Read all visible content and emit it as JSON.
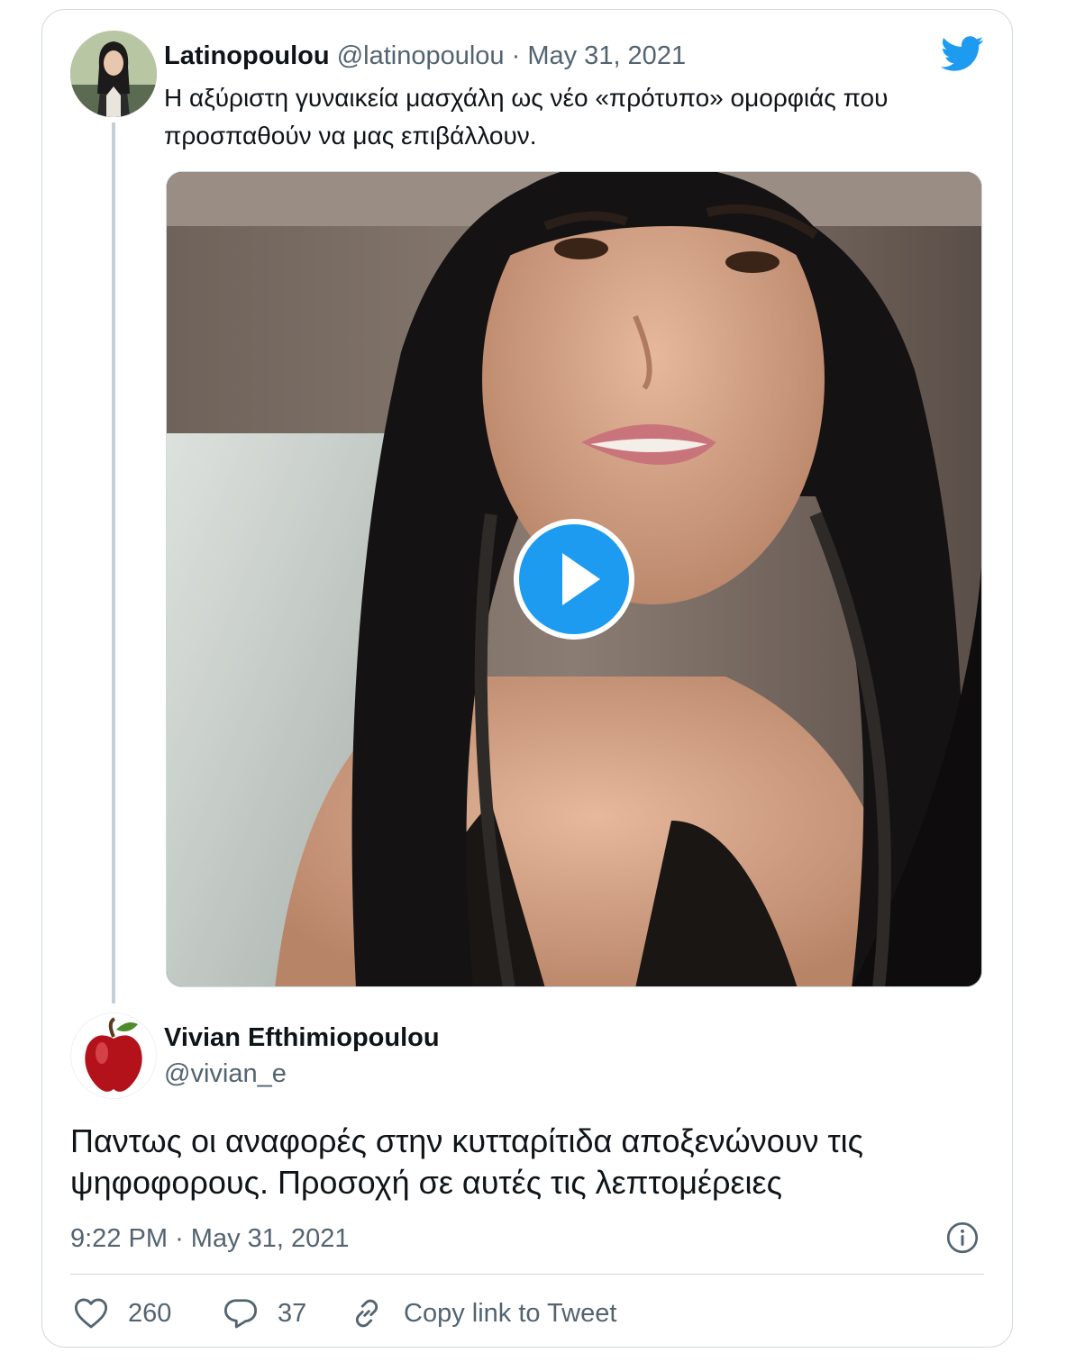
{
  "parent_tweet": {
    "name": "Latinopoulou",
    "handle": "@latinopoulou",
    "separator": "·",
    "date": "May 31, 2021",
    "text": "Η αξύριστη γυναικεία μασχάλη ως νέο «πρότυπο» ομορφιάς που προσπαθούν να μας επιβάλλουν."
  },
  "reply_tweet": {
    "name": "Vivian Efthimiopoulou",
    "handle": "@vivian_e",
    "text": "Παντως οι αναφορές στην κυτταρίτιδα αποξενώνουν τις ψηφοφορους. Προσοχή σε αυτές τις λεπτομέρειες",
    "time": "9:22 PM",
    "separator": "·",
    "date": "May 31, 2021"
  },
  "actions": {
    "like_count": "260",
    "reply_count": "37",
    "copy_label": "Copy link to Tweet"
  },
  "icons": {
    "brand": "twitter-bird-icon",
    "play": "play-icon",
    "info": "info-icon",
    "like": "heart-icon",
    "reply": "speech-bubble-icon",
    "copy": "link-icon"
  },
  "colors": {
    "accent": "#1d9bf0",
    "secondary_text": "#536471",
    "border": "#cfd9de"
  }
}
